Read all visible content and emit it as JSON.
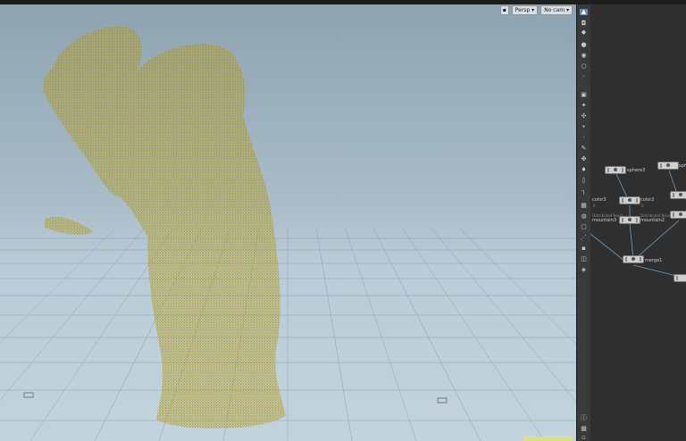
{
  "viewport": {
    "camera_menu": "Persp",
    "camera_select": "No cam"
  },
  "shelf": {
    "tools": [
      "select-icon",
      "lock-icon",
      "handle-icon",
      "sphere-icon",
      "light-icon",
      "point-light-icon",
      "spot-light-icon",
      "camera-icon",
      "view-icon",
      "transform-icon",
      "brush-icon",
      "dot-icon",
      "pen-icon",
      "sculpt-icon",
      "paint-icon",
      "magnet-icon",
      "measure-icon",
      "grid-icon",
      "snap-icon",
      "display-icon",
      "wire-icon",
      "shade-icon",
      "split-icon",
      "bone-icon",
      "cube-icon",
      "eye-icon",
      "info-icon",
      "layout-icon"
    ]
  },
  "network": {
    "nodes": [
      {
        "name": "sphere3",
        "sub": ""
      },
      {
        "name": "sph",
        "sub": ""
      },
      {
        "name": "color3",
        "sub": "0"
      },
      {
        "name": "color2",
        "sub": "0"
      },
      {
        "name": "mountain3",
        "sub": "Distributed Noise"
      },
      {
        "name": "mountain2",
        "sub": "Distributed Noise"
      },
      {
        "name": "merge1",
        "sub": ""
      }
    ]
  }
}
